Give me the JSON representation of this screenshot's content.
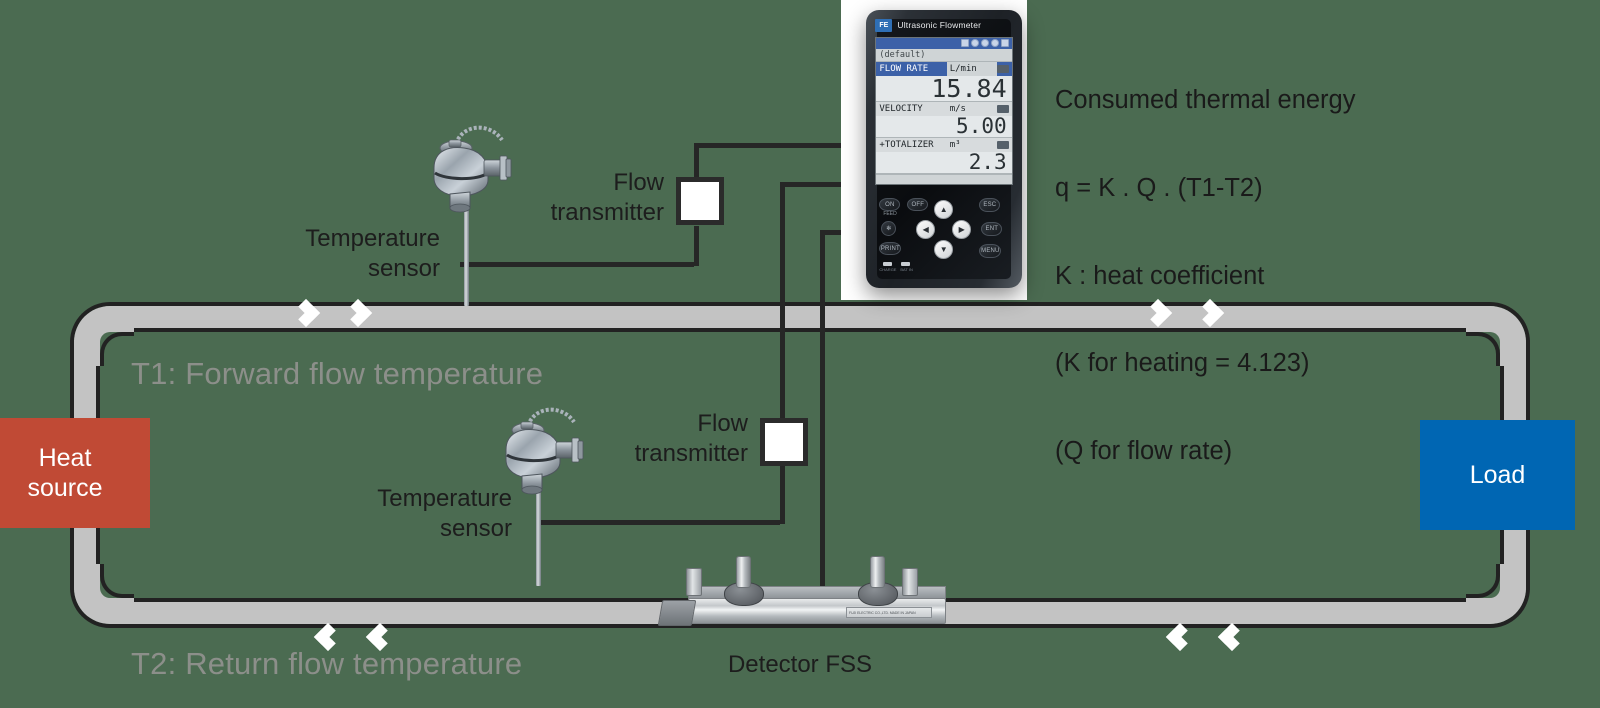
{
  "background_color": "#4b6b51",
  "formula": {
    "lines": [
      "Consumed thermal energy",
      "q = K . Q . (T1-T2)",
      "K : heat coefficient",
      "(K for heating = 4.123)",
      "(Q for flow rate)"
    ]
  },
  "pipes": {
    "forward_label": "T1: Forward flow temperature",
    "return_label": "T2: Return flow temperature",
    "pipe_color": "#c3c3c3",
    "outline_color": "#222222",
    "arrow_color": "#ffffff",
    "label_color": "#8c8f8a"
  },
  "heat_source": {
    "line1": "Heat",
    "line2": "source",
    "color": "#c04a35"
  },
  "load": {
    "label": "Load",
    "color": "#0066b3"
  },
  "sensors": [
    {
      "name": "temperature-sensor-forward",
      "line1": "Temperature",
      "line2": "sensor"
    },
    {
      "name": "temperature-sensor-return",
      "line1": "Temperature",
      "line2": "sensor"
    }
  ],
  "transmitters": [
    {
      "name": "flow-transmitter-forward",
      "line1": "Flow",
      "line2": "transmitter"
    },
    {
      "name": "flow-transmitter-return",
      "line1": "Flow",
      "line2": "transmitter"
    }
  ],
  "detector": {
    "label": "Detector FSS",
    "plate_text": "FUJI ELECTRIC CO.,LTD.   MADE IN JAPAN"
  },
  "device": {
    "brand": "Ultrasonic Flowmeter",
    "logo_text": "FE",
    "lcd": {
      "tag": "(default)",
      "rows": [
        {
          "name": "FLOW RATE",
          "unit": "L/min",
          "value": "15.84",
          "selected": true
        },
        {
          "name": "VELOCITY",
          "unit": "m/s",
          "value": "5.00",
          "selected": false
        },
        {
          "name": "+TOTALIZER",
          "unit": "m³",
          "value": "2.3",
          "selected": false
        }
      ]
    },
    "keys": {
      "on": "ON",
      "on_sub": "FEED",
      "off": "OFF",
      "esc": "ESC",
      "ent": "ENT",
      "print": "PRINT",
      "menu": "MENU",
      "light": "✻",
      "up": "▲",
      "down": "▼",
      "left": "◀",
      "right": "▶"
    },
    "leds": [
      {
        "label": "CHARGE"
      },
      {
        "label": "BAT IN"
      }
    ]
  }
}
